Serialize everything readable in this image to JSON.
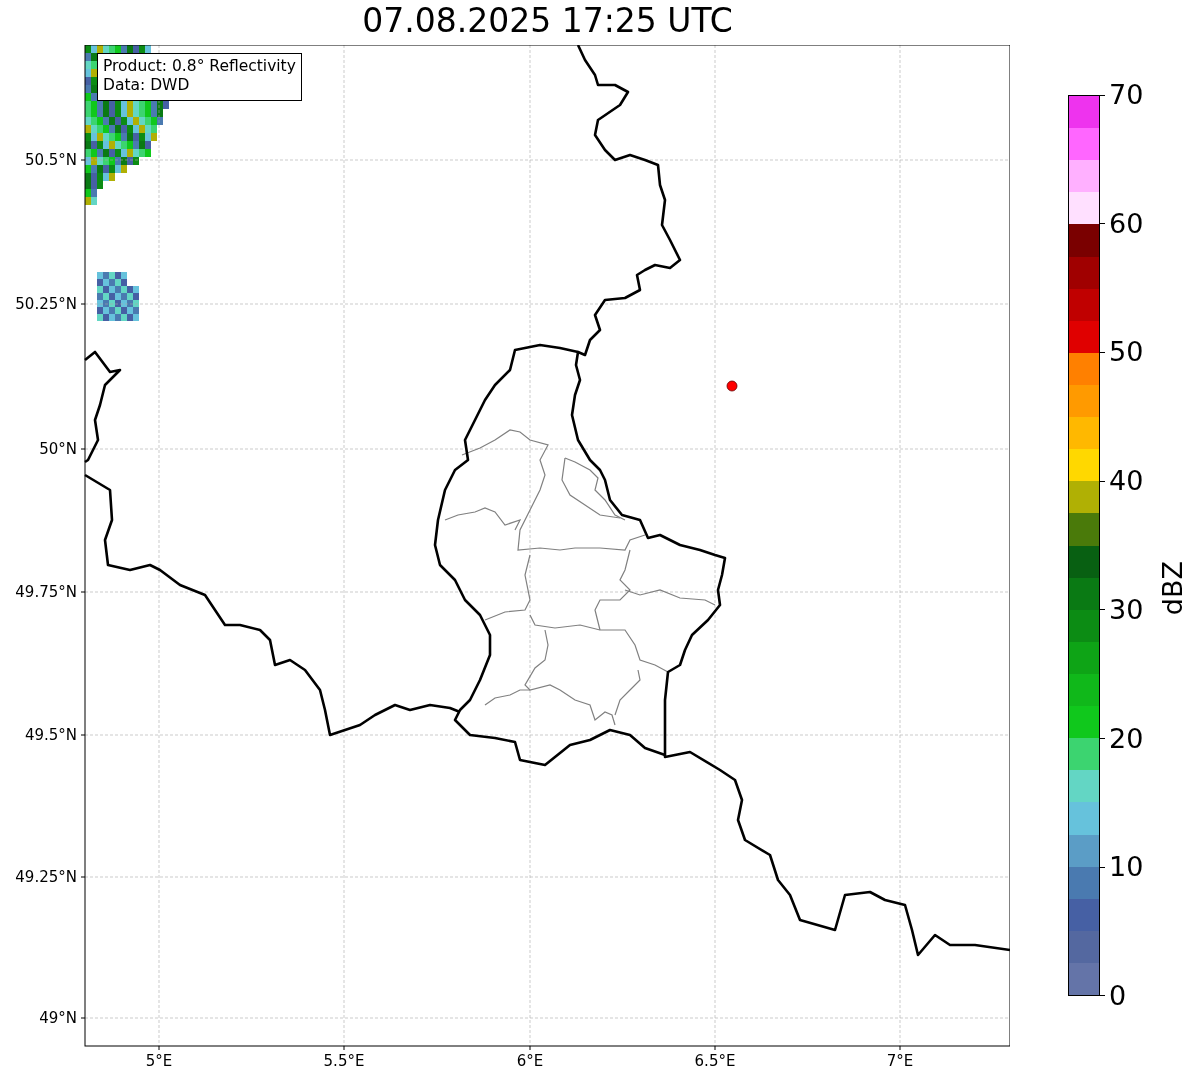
{
  "title": "07.08.2025 17:25 UTC",
  "info_box": [
    "Product: 0.8° Reflectivity",
    "Data: DWD"
  ],
  "map": {
    "lat_labels": [
      "50.5°N",
      "50.25°N",
      "50°N",
      "49.75°N",
      "49.5°N",
      "49.25°N",
      "49°N"
    ],
    "lon_labels": [
      "5°E",
      "5.5°E",
      "6°E",
      "6.5°E",
      "7°E"
    ],
    "marker": {
      "color": "#ff0000"
    }
  },
  "colorbar": {
    "label": "dBZ",
    "ticks": [
      "70",
      "60",
      "50",
      "40",
      "30",
      "20",
      "10",
      "0"
    ],
    "bands": [
      {
        "color": "#ee33ee"
      },
      {
        "color": "#ff66ff"
      },
      {
        "color": "#ffb0ff"
      },
      {
        "color": "#ffe0ff"
      },
      {
        "color": "#7a0000"
      },
      {
        "color": "#a00000"
      },
      {
        "color": "#c00000"
      },
      {
        "color": "#e00000"
      },
      {
        "color": "#ff8000"
      },
      {
        "color": "#ff9a00"
      },
      {
        "color": "#ffb800"
      },
      {
        "color": "#ffd800"
      },
      {
        "color": "#b0b004"
      },
      {
        "color": "#4a7a0a"
      },
      {
        "color": "#086012"
      },
      {
        "color": "#0a7a14"
      },
      {
        "color": "#0c8c14"
      },
      {
        "color": "#0ea416"
      },
      {
        "color": "#10b81a"
      },
      {
        "color": "#10c81c"
      },
      {
        "color": "#3cd470"
      },
      {
        "color": "#63d6c4"
      },
      {
        "color": "#66c2dc"
      },
      {
        "color": "#5b9dc6"
      },
      {
        "color": "#4a7ab0"
      },
      {
        "color": "#4660a4"
      },
      {
        "color": "#5468a0"
      },
      {
        "color": "#6474a8"
      }
    ]
  }
}
